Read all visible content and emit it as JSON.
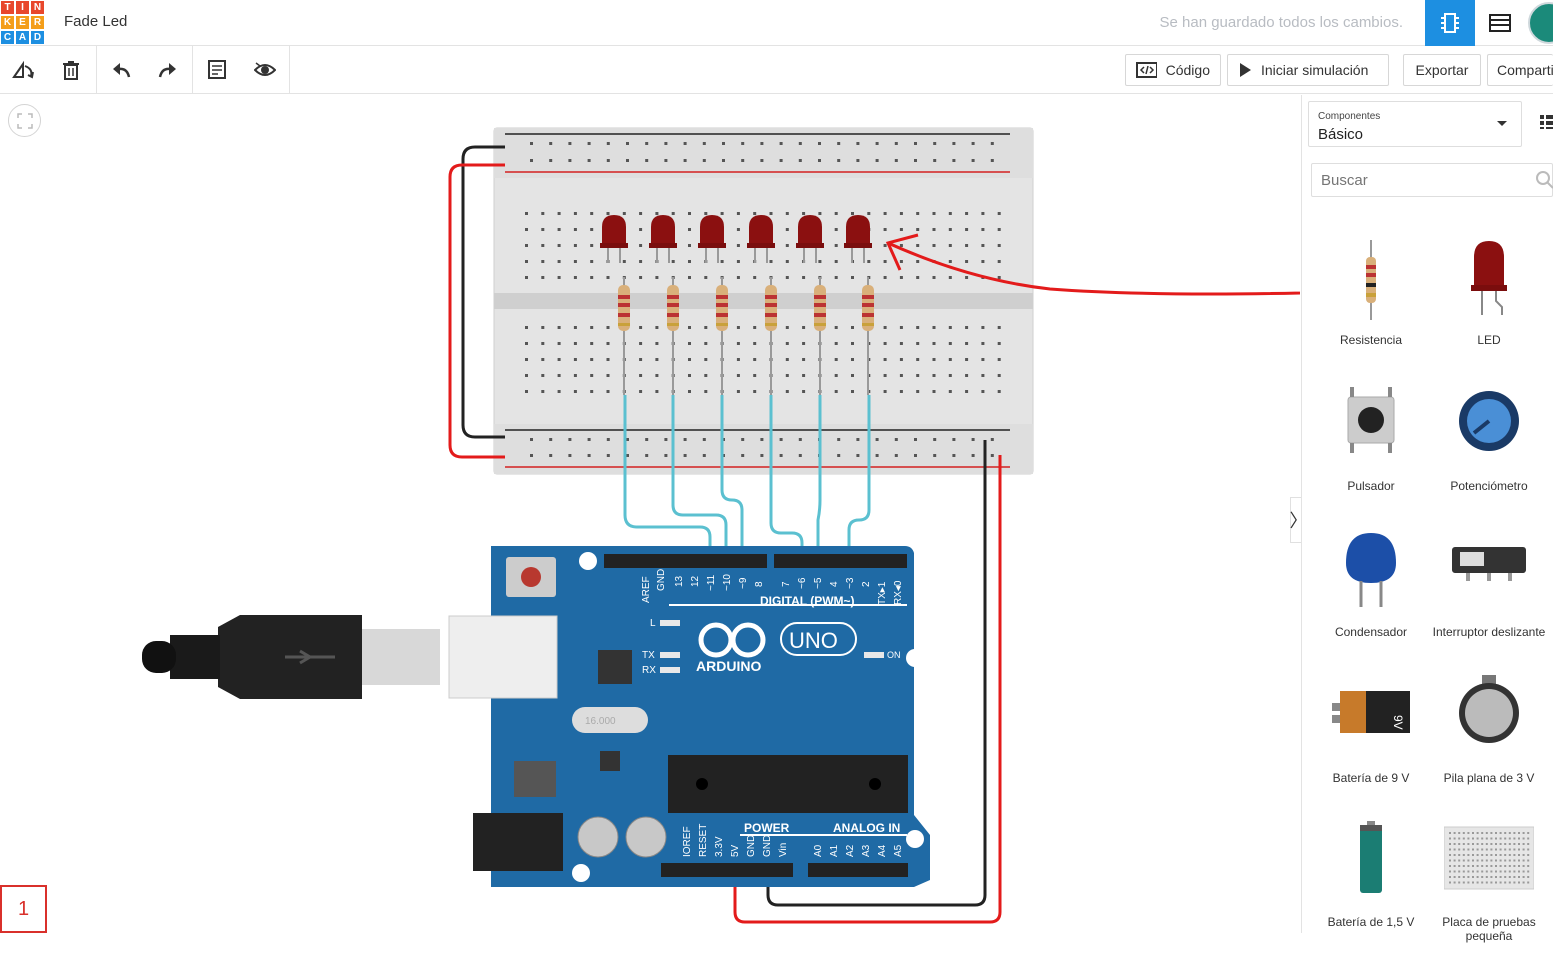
{
  "app": {
    "logo_letters": [
      "T",
      "I",
      "N",
      "K",
      "E",
      "R",
      "C",
      "A",
      "D"
    ],
    "project_title": "Fade Led",
    "save_status": "Se han guardado todos los cambios."
  },
  "toolbar": {
    "icons": [
      "rotate-icon",
      "delete-icon",
      "undo-icon",
      "redo-icon",
      "notes-icon",
      "visibility-icon"
    ],
    "code_label": "Código",
    "simulate_label": "Iniciar simulación",
    "export_label": "Exportar",
    "share_label": "Compartir"
  },
  "canvas": {
    "page_number": "1",
    "arduino": {
      "brand": "ARDUINO",
      "model": "UNO",
      "digital_label": "DIGITAL (PWM~)",
      "power_label": "POWER",
      "analog_label": "ANALOG IN",
      "on_label": "ON",
      "crystal_label": "16.000"
    }
  },
  "sidebar": {
    "select_caption": "Componentes",
    "select_value": "Básico",
    "search_placeholder": "Buscar",
    "components": [
      {
        "label": "Resistencia",
        "icon": "resistor-icon"
      },
      {
        "label": "LED",
        "icon": "led-icon"
      },
      {
        "label": "Pulsador",
        "icon": "pushbutton-icon"
      },
      {
        "label": "Potenciómetro",
        "icon": "potentiometer-icon"
      },
      {
        "label": "Condensador",
        "icon": "capacitor-icon"
      },
      {
        "label": "Interruptor deslizante",
        "icon": "slide-switch-icon"
      },
      {
        "label": "Batería de 9 V",
        "icon": "battery-9v-icon"
      },
      {
        "label": "Pila plana de 3 V",
        "icon": "coin-cell-icon"
      },
      {
        "label": "Batería de 1,5 V",
        "icon": "battery-aa-icon"
      },
      {
        "label": "Placa de pruebas pequeña",
        "icon": "small-breadboard-icon"
      }
    ]
  },
  "colors": {
    "accent": "#1d8fe1",
    "arduino_blue": "#1f6aa5",
    "led_red": "#8b1010",
    "wire_cyan": "#5bc0d0",
    "annotation_red": "#e31b1b"
  }
}
